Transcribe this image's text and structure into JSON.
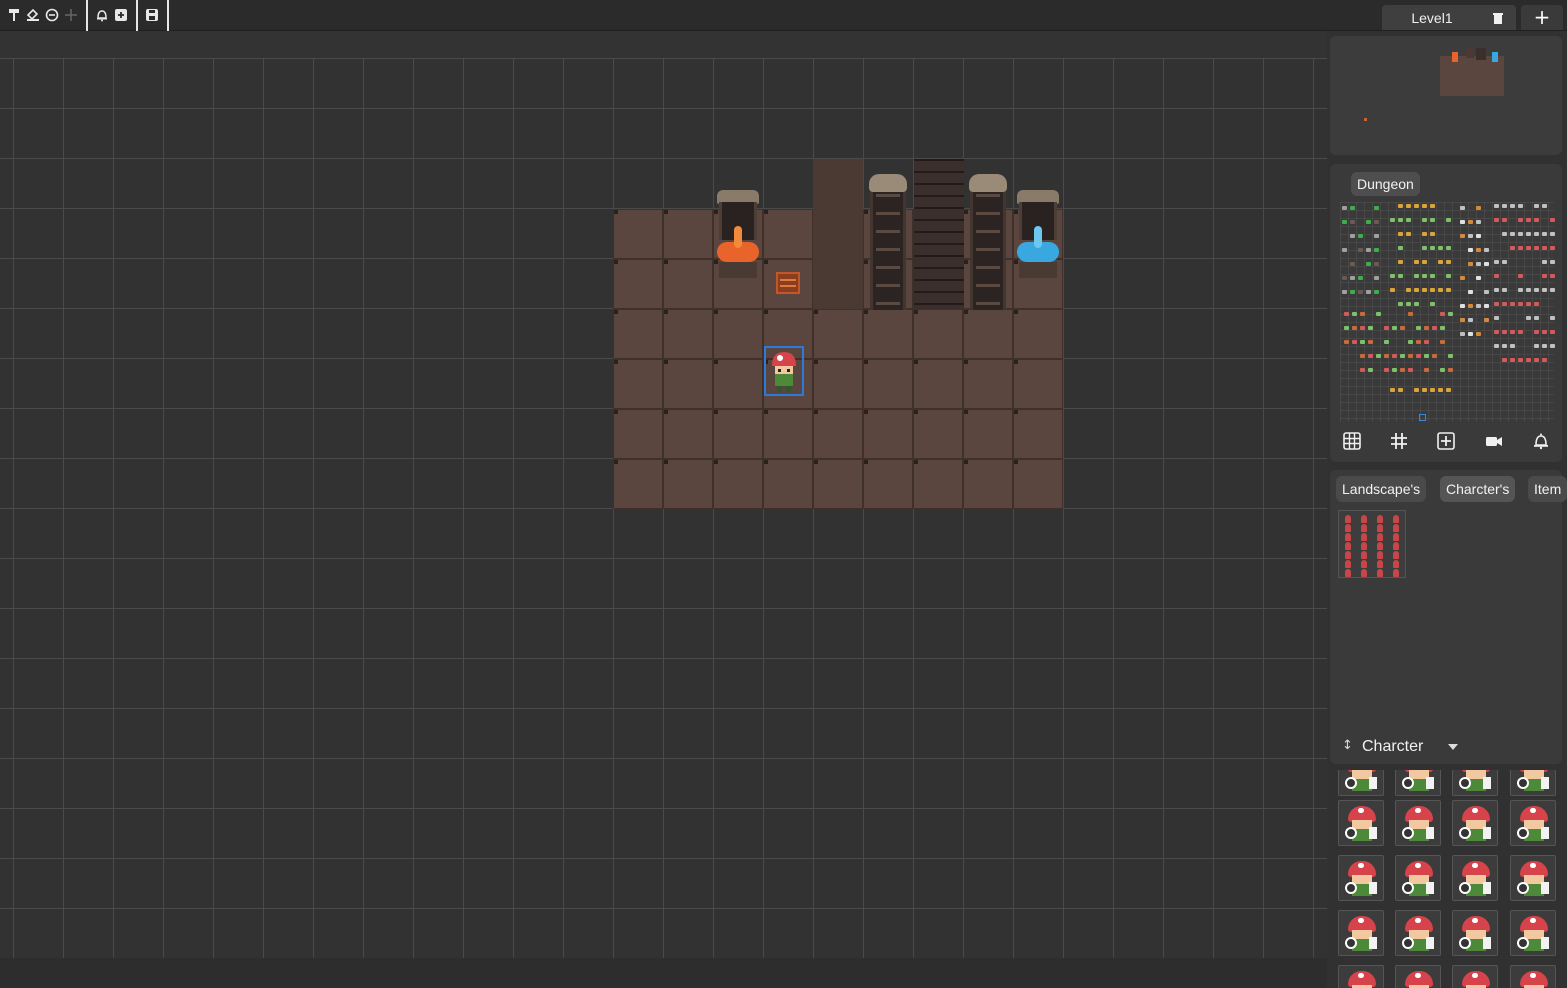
{
  "toolbar": {
    "tools": [
      {
        "name": "paint-roller-icon",
        "glyph": "🖌"
      },
      {
        "name": "fill-bucket-icon",
        "glyph": "⛾"
      },
      {
        "name": "erase-circle-icon",
        "glyph": "⊖"
      },
      {
        "name": "move-icon",
        "glyph": "✥"
      },
      {
        "name": "bell-add-icon",
        "glyph": "🔔"
      },
      {
        "name": "square-plus-icon",
        "glyph": "⊞"
      },
      {
        "name": "save-icon",
        "glyph": "💾"
      }
    ]
  },
  "level_tab": {
    "label": "Level1",
    "delete_icon": "trash-icon"
  },
  "add_level": {
    "label": "+"
  },
  "tileset_panel": {
    "selected_tileset": "Dungeon",
    "tools": [
      "grid-icon",
      "snap-grid-icon",
      "add-tile-icon",
      "camera-icon",
      "collision-bell-icon"
    ]
  },
  "asset_tabs": [
    {
      "label": "Landscape's",
      "active": false
    },
    {
      "label": "Charcter's",
      "active": true
    },
    {
      "label": "Item",
      "active": false
    }
  ],
  "character_dropdown": {
    "label": "Charcter",
    "icon": "sort-icon"
  },
  "colors": {
    "background": "#313131",
    "panel": "#3a3a3a",
    "accent_selection": "#2f7ad8",
    "floor": "#5a463e",
    "lava": "#e8642a",
    "water": "#3aa8e0"
  }
}
